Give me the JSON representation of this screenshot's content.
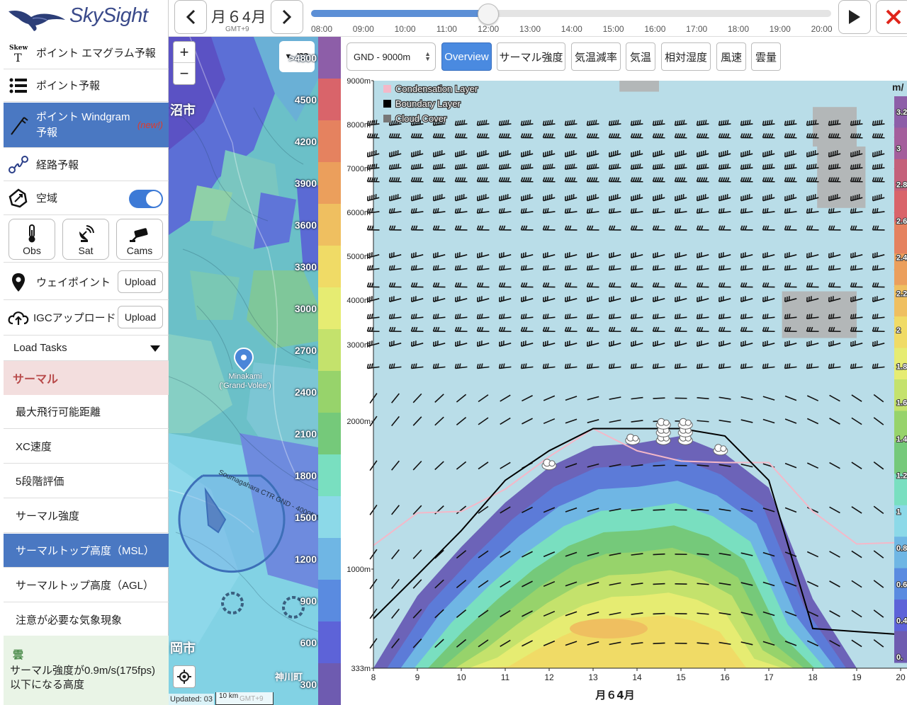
{
  "app": {
    "brand": "SkySight"
  },
  "timeline": {
    "date": "月６4月",
    "timezone": "GMT+9",
    "times": [
      "08:00",
      "09:00",
      "10:00",
      "11:00",
      "12:00",
      "13:00",
      "14:00",
      "15:00",
      "16:00",
      "17:00",
      "18:00",
      "19:00",
      "20:00"
    ],
    "selected": "12:00",
    "progress": 0.333
  },
  "sidebar": {
    "skew_badge": "Skew T",
    "items": [
      {
        "label": "ポイント エマグラム予報"
      },
      {
        "label": "ポイント予報"
      },
      {
        "label": "ポイント Windgram 予報",
        "tag": "(new!)"
      },
      {
        "label": "経路予報"
      },
      {
        "label": "空域",
        "toggle": true
      }
    ],
    "tiles": [
      {
        "label": "Obs"
      },
      {
        "label": "Sat"
      },
      {
        "label": "Cams"
      }
    ],
    "waypoint_label": "ウェイポイント",
    "igc_label": "IGCアップロード",
    "upload_label": "Upload",
    "load_tasks": "Load Tasks",
    "thermal_header": "サーマル",
    "thermal_items": [
      {
        "label": "最大飛行可能距離"
      },
      {
        "label": "XC速度"
      },
      {
        "label": "5段階評価"
      },
      {
        "label": "サーマル強度"
      },
      {
        "label": "サーマルトップ高度（MSL）",
        "active": true
      },
      {
        "label": "サーマルトップ高度（AGL）"
      },
      {
        "label": "注意が必要な気象現象"
      }
    ],
    "cloud_header": "雲",
    "cloud_desc": "サーマル強度が0.9m/s(175fps)以下になる高度"
  },
  "map": {
    "unit": "m",
    "places": [
      "沼市",
      "岡市",
      "神川町"
    ],
    "pin": "Minakami\n('Grand-Volee')",
    "airspace_labels": [
      "Soumagahara CTR  GND - 4000ft MSL"
    ],
    "updated": "Updated: 03",
    "scale": "10 km",
    "gmt_overlay": "GMT+9"
  },
  "legend": {
    "values": [
      ">4800",
      "4500",
      "4200",
      "3900",
      "3600",
      "3300",
      "3000",
      "2700",
      "2400",
      "2100",
      "1800",
      "1500",
      "1200",
      "900",
      "600",
      "300"
    ],
    "colors": [
      "#8d5ea8",
      "#d9646a",
      "#e5825f",
      "#eb9f5c",
      "#efbf60",
      "#f0db66",
      "#e6ec72",
      "#c4e26c",
      "#97d36b",
      "#75c97a",
      "#79dfc0",
      "#8cd9e8",
      "#6fb6e4",
      "#5a8be0",
      "#5d63d8",
      "#6e5bb0"
    ]
  },
  "windgram": {
    "range_label": "GND - 9000m",
    "tabs": [
      "Overview",
      "サーマル強度",
      "気温減率",
      "気温",
      "相対湿度",
      "風速",
      "雲量"
    ],
    "active_tab": "Overview",
    "legend": [
      {
        "name": "Condensation Layer",
        "color": "#f4b8c8"
      },
      {
        "name": "Boundary Layer",
        "color": "#000000"
      },
      {
        "name": "Cloud Cover",
        "color": "#777777"
      }
    ],
    "xlabel": "月６4月",
    "right_unit": "m/",
    "right_values": [
      "3.2",
      "3",
      "2.8",
      "2.6",
      "2.4",
      "2.2",
      "2",
      "1.8",
      "1.6",
      "1.4",
      "1.2",
      "1",
      "0.8",
      "0.6",
      "0.4",
      "0."
    ]
  },
  "chart_data": {
    "type": "heatmap",
    "x_label": "月６4月",
    "x": [
      8,
      9,
      10,
      11,
      12,
      13,
      14,
      15,
      16,
      17,
      18,
      19,
      20
    ],
    "y_ticks": [
      "333m",
      "1000m",
      "2000m",
      "3000m",
      "4000m",
      "5000m",
      "6000m",
      "7000m",
      "8000m",
      "9000m"
    ],
    "y_values": [
      333,
      1000,
      2000,
      3000,
      4000,
      5000,
      6000,
      7000,
      8000,
      9000
    ],
    "boundary_layer": [
      {
        "x": 8,
        "y": 666
      },
      {
        "x": 9,
        "y": 960
      },
      {
        "x": 10,
        "y": 1260
      },
      {
        "x": 11,
        "y": 1600
      },
      {
        "x": 12,
        "y": 1800
      },
      {
        "x": 13,
        "y": 1950
      },
      {
        "x": 14,
        "y": 1950
      },
      {
        "x": 15,
        "y": 1950
      },
      {
        "x": 16,
        "y": 1900
      },
      {
        "x": 17,
        "y": 1600
      },
      {
        "x": 18,
        "y": 600
      },
      {
        "x": 19,
        "y": 580
      },
      {
        "x": 20,
        "y": 560
      }
    ],
    "condensation_layer": [
      {
        "x": 8,
        "y": 1160
      },
      {
        "x": 9,
        "y": 1380
      },
      {
        "x": 10,
        "y": 1390
      },
      {
        "x": 11,
        "y": 1540
      },
      {
        "x": 12,
        "y": 1760
      },
      {
        "x": 13,
        "y": 1950
      },
      {
        "x": 14,
        "y": 1800
      },
      {
        "x": 15,
        "y": 1730
      },
      {
        "x": 16,
        "y": 1720
      },
      {
        "x": 17,
        "y": 1720
      },
      {
        "x": 18,
        "y": 1390
      },
      {
        "x": 19,
        "y": 1170
      },
      {
        "x": 20,
        "y": 1180
      }
    ],
    "thermal_peak": {
      "x": 14,
      "y": 1850,
      "max_strength": 2.4
    },
    "thermal_profile": [
      {
        "x": 8,
        "top": 333
      },
      {
        "x": 9,
        "top": 820
      },
      {
        "x": 10,
        "top": 1150
      },
      {
        "x": 11,
        "top": 1450
      },
      {
        "x": 12,
        "top": 1690
      },
      {
        "x": 13,
        "top": 1830
      },
      {
        "x": 14,
        "top": 1850
      },
      {
        "x": 15,
        "top": 1900
      },
      {
        "x": 16,
        "top": 1780
      },
      {
        "x": 17,
        "top": 1550
      },
      {
        "x": 18,
        "top": 800
      },
      {
        "x": 19,
        "top": 333
      },
      {
        "x": 20,
        "top": 333
      }
    ]
  }
}
